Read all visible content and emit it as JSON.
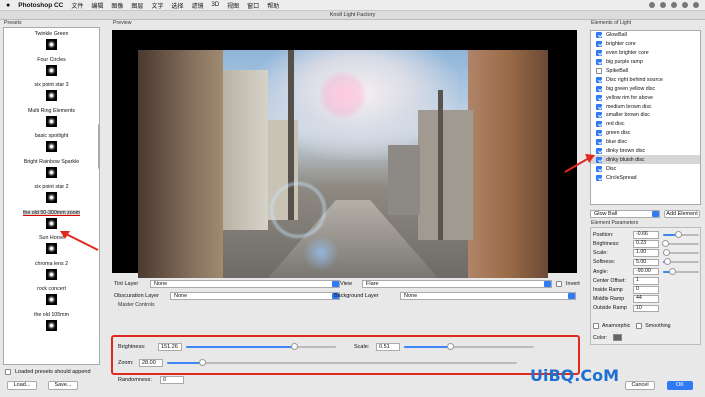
{
  "menubar": {
    "app": "Photoshop CC",
    "items": [
      "文件",
      "编辑",
      "图像",
      "图层",
      "文字",
      "选择",
      "滤镜",
      "3D",
      "视图",
      "窗口",
      "帮助"
    ]
  },
  "window_title": "Knoll Light Factory",
  "presets": {
    "label": "Presets",
    "items": [
      {
        "name": "Twinkle Green"
      },
      {
        "name": "Four Circles"
      },
      {
        "name": "six point star 3"
      },
      {
        "name": "Multi Ring Elements"
      },
      {
        "name": "basic spotlight"
      },
      {
        "name": "Bright Rainbow Sparkle"
      },
      {
        "name": "six point star 2"
      },
      {
        "name": "the old 50-300mm zoom",
        "selected": true
      },
      {
        "name": "Sun Horse"
      },
      {
        "name": "chroma lens 2"
      },
      {
        "name": "rock concert"
      },
      {
        "name": "the old 105mm"
      }
    ],
    "append_label": "Loaded presets should append",
    "append_checked": false,
    "load_label": "Load...",
    "save_label": "Save..."
  },
  "preview": {
    "label": "Preview"
  },
  "layers": {
    "tint_label": "Tint Layer",
    "tint_value": "None",
    "view_label": "View",
    "view_value": "Flare",
    "invert_label": "Invert",
    "invert_checked": false,
    "obscuration_label": "Obscuration Layer",
    "obscuration_value": "None",
    "background_label": "Background Layer",
    "background_value": "None"
  },
  "master": {
    "label": "Master Controls",
    "brightness_label": "Brightness:",
    "brightness_value": "151.26",
    "brightness_level": 0.72,
    "scale_label": "Scale:",
    "scale_value": "0.51",
    "scale_level": 0.36,
    "zoom_label": "Zoom:",
    "zoom_value": "28.00",
    "zoom_level": 0.1,
    "randomness_label": "Randomness:",
    "randomness_value": "0"
  },
  "elements": {
    "label": "Elements of Light",
    "items": [
      {
        "name": "GlowBall",
        "checked": true
      },
      {
        "name": "brighter core",
        "checked": true
      },
      {
        "name": "even brighter core",
        "checked": true
      },
      {
        "name": "big purple ramp",
        "checked": true
      },
      {
        "name": "SpikeBall",
        "checked": false
      },
      {
        "name": "Disc right behind source",
        "checked": true
      },
      {
        "name": "big green yellow disc",
        "checked": true
      },
      {
        "name": "yellow rim for above",
        "checked": true
      },
      {
        "name": "medium brown disc",
        "checked": true
      },
      {
        "name": "smaller brown disc",
        "checked": true
      },
      {
        "name": "red disc",
        "checked": true
      },
      {
        "name": "green disc",
        "checked": true
      },
      {
        "name": "blue disc",
        "checked": true
      },
      {
        "name": "dinky brown disc",
        "checked": true
      },
      {
        "name": "dinky bluish disc",
        "checked": true,
        "selected": true
      },
      {
        "name": "Disc",
        "checked": true
      },
      {
        "name": "CircleSpread",
        "checked": true
      }
    ]
  },
  "element_select": {
    "value": "Glow Ball",
    "add_label": "Add Element"
  },
  "params": {
    "label": "Element Parameters",
    "rows": [
      {
        "label": "Position:",
        "value": "-0.66",
        "level": 0.42
      },
      {
        "label": "Brightness:",
        "value": "0.23",
        "level": 0.08
      },
      {
        "label": "Scale:",
        "value": "1.00",
        "level": 0.1
      },
      {
        "label": "Softness:",
        "value": "5.00",
        "level": 0.12
      },
      {
        "label": "Angle:",
        "value": "-90.00",
        "level": 0.25
      },
      {
        "label": "Center Offset:",
        "value": "1",
        "level": null
      },
      {
        "label": "Inside Ramp",
        "value": "0",
        "level": null
      },
      {
        "label": "Middle Ramp",
        "value": "44",
        "level": null
      },
      {
        "label": "Outside Ramp",
        "value": "10",
        "level": null
      }
    ],
    "anamorphic_label": "Anamorphic",
    "smoothing_label": "Smoothing",
    "color_label": "Color:"
  },
  "footer": {
    "cancel_label": "Cancel",
    "ok_label": "OK"
  },
  "watermark": "UiBQ.CoM",
  "colors": {
    "accent": "#2f7bf5",
    "highlight_box": "#e0281e"
  }
}
